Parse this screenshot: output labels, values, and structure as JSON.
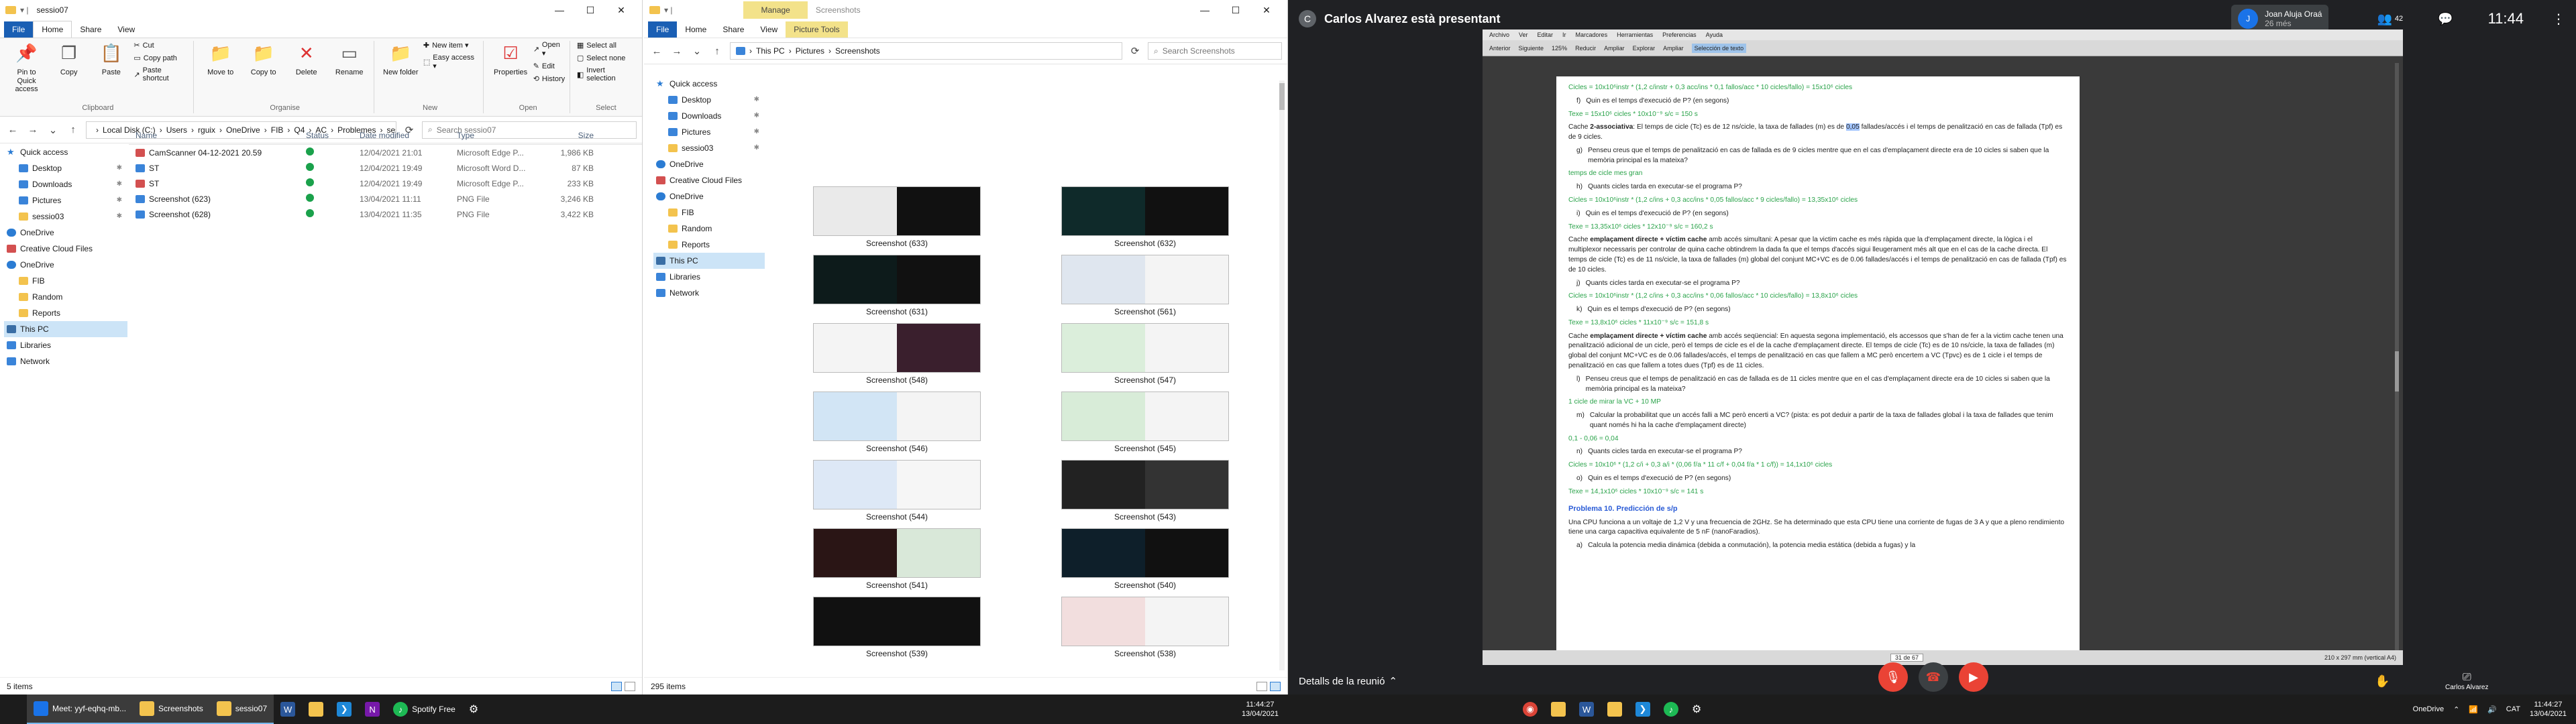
{
  "window1": {
    "title": "sessio07",
    "tabs": [
      "File",
      "Home",
      "Share",
      "View"
    ],
    "active_tab": "Home",
    "ribbon": {
      "clipboard": {
        "label": "Clipboard",
        "pin": "Pin to Quick access",
        "copy": "Copy",
        "paste": "Paste",
        "cut": "Cut",
        "copy_path": "Copy path",
        "paste_shortcut": "Paste shortcut"
      },
      "organise": {
        "label": "Organise",
        "move_to": "Move to",
        "copy_to": "Copy to",
        "delete": "Delete",
        "rename": "Rename"
      },
      "new": {
        "label": "New",
        "new_folder": "New folder",
        "new_item": "New item ▾",
        "easy_access": "Easy access ▾"
      },
      "open": {
        "label": "Open",
        "properties": "Properties",
        "open": "Open ▾",
        "edit": "Edit",
        "history": "History"
      },
      "select": {
        "label": "Select",
        "select_all": "Select all",
        "select_none": "Select none",
        "invert": "Invert selection"
      }
    },
    "address": [
      "Local Disk (C:)",
      "Users",
      "rguix",
      "OneDrive",
      "FIB",
      "Q4",
      "AC",
      "Problemes",
      "sessio07"
    ],
    "search_placeholder": "Search sessio07",
    "nav": [
      {
        "label": "Quick access",
        "icon": "star"
      },
      {
        "label": "Desktop",
        "icon": "blue",
        "pin": true
      },
      {
        "label": "Downloads",
        "icon": "blue",
        "pin": true
      },
      {
        "label": "Pictures",
        "icon": "blue",
        "pin": true
      },
      {
        "label": "sessio03",
        "icon": "folder",
        "pin": true
      },
      {
        "label": "OneDrive",
        "icon": "cloud"
      },
      {
        "label": "Creative Cloud Files",
        "icon": "red"
      },
      {
        "label": "OneDrive",
        "icon": "cloud"
      },
      {
        "label": "FIB",
        "icon": "folder"
      },
      {
        "label": "Random",
        "icon": "folder"
      },
      {
        "label": "Reports",
        "icon": "folder"
      },
      {
        "label": "This PC",
        "icon": "pc",
        "selected": true
      },
      {
        "label": "Libraries",
        "icon": "blue"
      },
      {
        "label": "Network",
        "icon": "blue"
      }
    ],
    "columns": [
      "Name",
      "Status",
      "Date modified",
      "Type",
      "Size"
    ],
    "files": [
      {
        "name": "CamScanner 04-12-2021 20.59",
        "date": "12/04/2021 21:01",
        "type": "Microsoft Edge P...",
        "size": "1,986 KB",
        "icon": "red"
      },
      {
        "name": "ST",
        "date": "12/04/2021 19:49",
        "type": "Microsoft Word D...",
        "size": "87 KB",
        "icon": "blue"
      },
      {
        "name": "ST",
        "date": "12/04/2021 19:49",
        "type": "Microsoft Edge P...",
        "size": "233 KB",
        "icon": "red"
      },
      {
        "name": "Screenshot (623)",
        "date": "13/04/2021 11:11",
        "type": "PNG File",
        "size": "3,246 KB",
        "icon": "blue"
      },
      {
        "name": "Screenshot (628)",
        "date": "13/04/2021 11:35",
        "type": "PNG File",
        "size": "3,422 KB",
        "icon": "blue"
      }
    ],
    "status": "5 items"
  },
  "window2": {
    "title": "Screenshots",
    "tabs": [
      "File",
      "Home",
      "Share",
      "View"
    ],
    "context_tab_group": "Manage",
    "context_tab": "Picture Tools",
    "address": [
      "This PC",
      "Pictures",
      "Screenshots"
    ],
    "search_placeholder": "Search Screenshots",
    "nav": [
      {
        "label": "Quick access",
        "icon": "star"
      },
      {
        "label": "Desktop",
        "icon": "blue",
        "pin": true
      },
      {
        "label": "Downloads",
        "icon": "blue",
        "pin": true
      },
      {
        "label": "Pictures",
        "icon": "blue",
        "pin": true
      },
      {
        "label": "sessio03",
        "icon": "folder",
        "pin": true
      },
      {
        "label": "OneDrive",
        "icon": "cloud"
      },
      {
        "label": "Creative Cloud Files",
        "icon": "red"
      },
      {
        "label": "OneDrive",
        "icon": "cloud"
      },
      {
        "label": "FIB",
        "icon": "folder"
      },
      {
        "label": "Random",
        "icon": "folder"
      },
      {
        "label": "Reports",
        "icon": "folder"
      },
      {
        "label": "This PC",
        "icon": "pc",
        "selected": true
      },
      {
        "label": "Libraries",
        "icon": "blue"
      },
      {
        "label": "Network",
        "icon": "blue"
      }
    ],
    "thumbs": [
      {
        "label": "Screenshot (633)",
        "a": "#eaeaea",
        "b": "#111"
      },
      {
        "label": "Screenshot (632)",
        "a": "#0f2a2a",
        "b": "#111"
      },
      {
        "label": "Screenshot (631)",
        "a": "#0d1b1b",
        "b": "#111"
      },
      {
        "label": "Screenshot (561)",
        "a": "#dfe6ef",
        "b": "#f4f4f4"
      },
      {
        "label": "Screenshot (548)",
        "a": "#f4f4f4",
        "b": "#3a1f2d"
      },
      {
        "label": "Screenshot (547)",
        "a": "#dbeedb",
        "b": "#f4f4f4"
      },
      {
        "label": "Screenshot (546)",
        "a": "#d2e5f5",
        "b": "#f4f4f4"
      },
      {
        "label": "Screenshot (545)",
        "a": "#d8ecd8",
        "b": "#f4f4f4"
      },
      {
        "label": "Screenshot (544)",
        "a": "#dde8f6",
        "b": "#f6f6f6"
      },
      {
        "label": "Screenshot (543)",
        "a": "#222",
        "b": "#333"
      },
      {
        "label": "Screenshot (541)",
        "a": "#2a1515",
        "b": "#d9e8d9"
      },
      {
        "label": "Screenshot (540)",
        "a": "#0e1f2a",
        "b": "#111"
      },
      {
        "label": "Screenshot (539)",
        "a": "#111",
        "b": "#111"
      },
      {
        "label": "Screenshot (538)",
        "a": "#f2dede",
        "b": "#f4f4f4"
      }
    ],
    "status": "295 items"
  },
  "taskbar_left": {
    "apps": [
      {
        "label": "Meet: yyf-eqhq-mb...",
        "color": "#1a73e8"
      },
      {
        "label": "Screenshots",
        "color": "#f3c34e"
      },
      {
        "label": "sessio07",
        "color": "#f3c34e"
      }
    ],
    "spotify": "Spotify Free",
    "time": "11:44:27",
    "date": "13/04/2021"
  },
  "meet": {
    "presenter_initial": "C",
    "presenter_text": "Carlos Alvarez està presentant",
    "user_initial": "J",
    "user_name": "Joan Aluja Oraá",
    "user_status": "26 més",
    "participant_count": "42",
    "clock": "11:44",
    "details": "Detalls de la reunió",
    "caption_label": "Carlos Alvarez"
  },
  "pdf": {
    "menu": [
      "Archivo",
      "Ver",
      "Editar",
      "Ir",
      "Marcadores",
      "Herramientas",
      "Preferencias",
      "Ayuda"
    ],
    "toolbar": [
      "Anterior",
      "Siguiente",
      "125%",
      "Reducir",
      "Ampliar",
      "Explorar",
      "Ampliar",
      "Selección de texto"
    ],
    "page_counter": "31 de 67",
    "page_size": "210 x 297 mm (vertical A4)",
    "lines": [
      {
        "cls": "g",
        "text": "Cicles = 10x10⁶instr * (1,2 c/instr + 0,3 acc/ins * 0,1 fallos/acc * 10 cicles/fallo) = 15x10⁶ cicles"
      },
      {
        "cls": "q",
        "num": "f)",
        "text": "Quin es el temps d'execució de P? (en segons)"
      },
      {
        "cls": "g",
        "text": "Texe = 15x10⁶ cicles * 10x10⁻⁹ s/c = 150 s"
      },
      {
        "cls": "p",
        "html": true,
        "text": "Cache <span class='bold'>2-associativa</span>: El temps de cicle (Tc) es de 12 ns/cicle, la taxa de fallades (m) es de <span class='hl'>0,05</span> fallades/accés i el temps de penalització en cas de fallada (Tpf) es de 9 cicles."
      },
      {
        "cls": "q",
        "num": "g)",
        "text": "Penseu creus que el temps de penalització en cas de fallada es de 9 cicles mentre que en el cas d'emplaçament directe era de 10 cicles si saben que la memòria principal es la mateixa?"
      },
      {
        "cls": "g",
        "text": "temps de cicle mes gran"
      },
      {
        "cls": "q",
        "num": "h)",
        "text": "Quants cicles tarda en executar-se el programa P?"
      },
      {
        "cls": "g",
        "text": "Cicles = 10x10⁶instr * (1,2 c/ins + 0,3 acc/ins * 0,05 fallos/acc * 9 cicles/fallo) = 13,35x10⁶ cicles"
      },
      {
        "cls": "q",
        "num": "i)",
        "text": "Quin es el temps d'execució de P? (en segons)"
      },
      {
        "cls": "g",
        "text": "Texe = 13,35x10⁶ cicles * 12x10⁻⁹ s/c = 160,2 s"
      },
      {
        "cls": "p",
        "html": true,
        "text": "Cache <span class='bold'>emplaçament directe + víctim cache</span> amb accés simultani: A pesar que la victim cache es més ràpida que la d'emplaçament directe, la lògica i el multiplexor necessaris per controlar de quina cache obtindrem la dada fa que el temps d'accés sigui lleugerament més alt que en el cas de la cache directa. El temps de cicle (Tc) es de 11 ns/cicle, la taxa de fallades (m) global del conjunt MC+VC es de 0.06 fallades/accés i el temps de penalització en cas de fallada (Tpf) es de 10 cicles."
      },
      {
        "cls": "q",
        "num": "j)",
        "text": "Quants cicles tarda en executar-se el programa P?"
      },
      {
        "cls": "g",
        "text": "Cicles = 10x10⁶instr * (1,2 c/ins + 0,3 acc/ins * 0,06 fallos/acc * 10 cicles/fallo) = 13,8x10⁶ cicles"
      },
      {
        "cls": "q",
        "num": "k)",
        "text": "Quin es el temps d'execució de P? (en segons)"
      },
      {
        "cls": "g",
        "text": "Texe = 13,8x10⁶ cicles * 11x10⁻⁹ s/c = 151,8 s"
      },
      {
        "cls": "p",
        "html": true,
        "text": "Cache <span class='bold'>emplaçament directe + víctim cache</span> amb accés seqüencial: En aquesta segona implementació, els accessos que s'han de fer a la victim cache tenen una penalització adicional de un cicle, però el temps de cicle es el de la cache d'emplaçament directe. El temps de cicle (Tc) es de 10 ns/cicle, la taxa de fallades (m) global del conjunt MC+VC es de 0.06 fallades/accés, el temps de penalització en cas que fallem a MC però encertem a VC (Tpvc) es de 1 cicle i el temps de penalització en cas que fallem a totes dues (Tpf) es de 11 cicles."
      },
      {
        "cls": "q",
        "num": "l)",
        "text": "Penseu creus que el temps de penalització en cas de fallada es de 11 cicles mentre que en el cas d'emplaçament directe era de 10 cicles si saben que la memòria principal es la mateixa?"
      },
      {
        "cls": "g",
        "text": "1 cicle de mirar la VC + 10 MP"
      },
      {
        "cls": "q",
        "num": "m)",
        "text": "Calcular la probabilitat que un accés falli a MC però encerti a VC? (pista: es pot deduir a partir de la taxa de fallades global i la taxa de fallades que tenim quant només hi ha la cache d'emplaçament directe)"
      },
      {
        "cls": "g",
        "text": "0,1 - 0,06 = 0,04"
      },
      {
        "cls": "q",
        "num": "n)",
        "text": "Quants cicles tarda en executar-se el programa P?"
      },
      {
        "cls": "g",
        "text": "Cicles = 10x10⁶ * (1,2 c/i + 0,3 a/i * (0,06 f/a * 11 c/f + 0,04 f/a * 1 c/f)) = 14,1x10⁶ cicles"
      },
      {
        "cls": "q",
        "num": "o)",
        "text": "Quin es el temps d'execució de P? (en segons)"
      },
      {
        "cls": "g",
        "text": "Texe = 14,1x10⁶ cicles * 10x10⁻⁹ s/c = 141 s"
      },
      {
        "cls": "title",
        "text": "Problema 10. Predicción de s/p"
      },
      {
        "cls": "p",
        "text": "Una CPU funciona a un voltaje de 1,2 V y una frecuencia de 2GHz. Se ha determinado que esta CPU tiene una corriente de fugas de 3 A y que a pleno rendimiento tiene una carga capacitiva equivalente de 5 nF (nanoFaradios)."
      },
      {
        "cls": "q",
        "num": "a)",
        "text": "Calcula la potencia media dinámica (debida a conmutación), la potencia media estática (debida a fugas) y la"
      }
    ]
  },
  "taskbar_right": {
    "onedrive": "OneDrive",
    "lang": "CAT",
    "time": "11:44:27",
    "date": "13/04/2021"
  },
  "colors": {
    "accent": "#1a5fb4",
    "meet_bg": "#202124",
    "taskbar": "#1c1c1c",
    "pdf_green": "#2aa34a",
    "pdf_blue": "#2b5cd6"
  }
}
